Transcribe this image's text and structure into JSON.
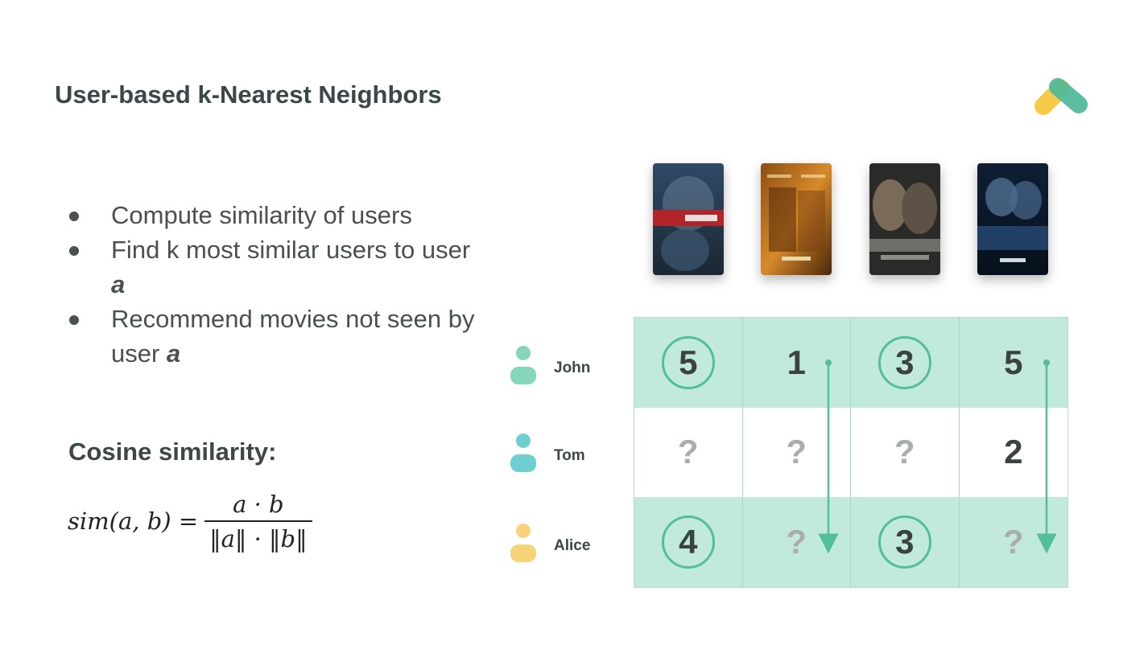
{
  "slide": {
    "title": "User-based k-Nearest Neighbors"
  },
  "bullets": [
    {
      "text": "Compute similarity of users",
      "var": ""
    },
    {
      "text": "Find k most similar users to user ",
      "var": "a"
    },
    {
      "text": "Recommend movies not seen by user ",
      "var": "a"
    }
  ],
  "cosine": {
    "title": "Cosine similarity:",
    "lhs": "sim(a, b) =",
    "numerator": "a · b",
    "denominator": "‖a‖ · ‖b‖"
  },
  "movies": [
    {
      "name": "ARGO"
    },
    {
      "name": "SEVEN"
    },
    {
      "name": "Insomnia"
    },
    {
      "name": "HEAT"
    }
  ],
  "users": [
    {
      "name": "John",
      "icon": "user-icon",
      "color": "#86d6b9"
    },
    {
      "name": "Tom",
      "icon": "user-icon",
      "color": "#6fcfd0"
    },
    {
      "name": "Alice",
      "icon": "user-icon",
      "color": "#f7d37a"
    }
  ],
  "ratings": [
    [
      {
        "value": "5",
        "circled": true
      },
      {
        "value": "1",
        "circled": false
      },
      {
        "value": "3",
        "circled": true
      },
      {
        "value": "5",
        "circled": false
      }
    ],
    [
      {
        "value": "?",
        "circled": false
      },
      {
        "value": "?",
        "circled": false
      },
      {
        "value": "?",
        "circled": false
      },
      {
        "value": "2",
        "circled": false
      }
    ],
    [
      {
        "value": "4",
        "circled": true
      },
      {
        "value": "?",
        "circled": false
      },
      {
        "value": "3",
        "circled": true
      },
      {
        "value": "?",
        "circled": false
      }
    ]
  ],
  "colors": {
    "accent_teal": "#52be9a",
    "row_highlight": "#c2eadc",
    "logo_yellow": "#f7c948",
    "logo_green": "#4fb99a"
  },
  "arrows": [
    {
      "column": 2,
      "from_row": 1,
      "to_row": 3,
      "meaning": "propagate rating from John to Alice"
    },
    {
      "column": 4,
      "from_row": 1,
      "to_row": 3,
      "meaning": "propagate rating from John to Alice"
    }
  ]
}
